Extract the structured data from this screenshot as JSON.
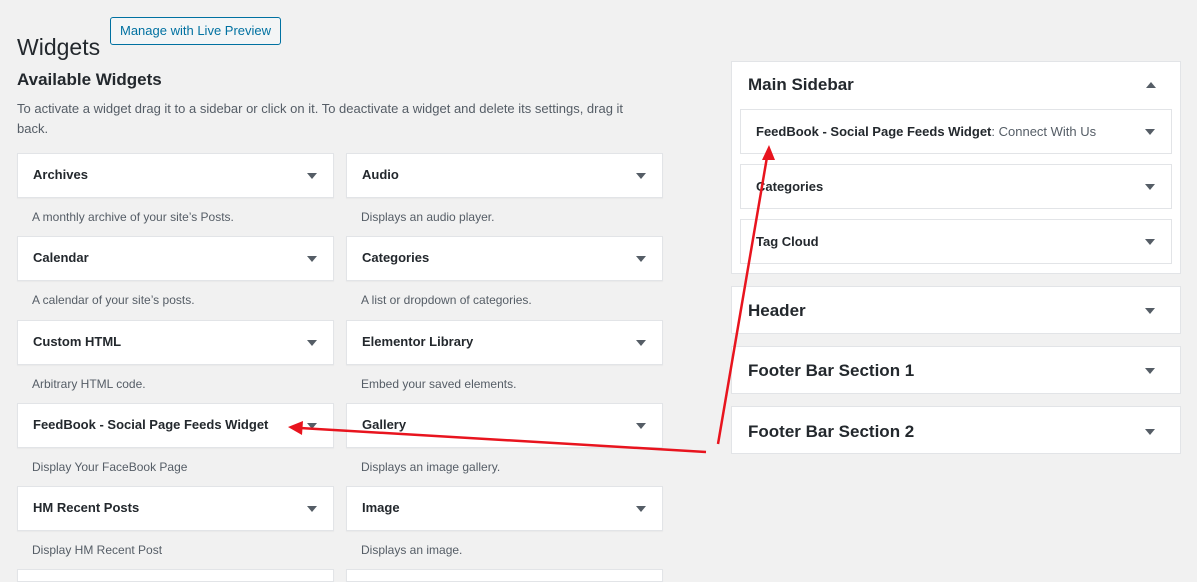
{
  "header": {
    "title": "Widgets",
    "live_preview_label": "Manage with Live Preview"
  },
  "available": {
    "title": "Available Widgets",
    "description": "To activate a widget drag it to a sidebar or click on it. To deactivate a widget and delete its settings, drag it back.",
    "widgets": [
      {
        "name": "Archives",
        "desc": "A monthly archive of your site’s Posts."
      },
      {
        "name": "Audio",
        "desc": "Displays an audio player."
      },
      {
        "name": "Calendar",
        "desc": "A calendar of your site’s posts."
      },
      {
        "name": "Categories",
        "desc": "A list or dropdown of categories."
      },
      {
        "name": "Custom HTML",
        "desc": "Arbitrary HTML code."
      },
      {
        "name": "Elementor Library",
        "desc": "Embed your saved elements."
      },
      {
        "name": "FeedBook - Social Page Feeds Widget",
        "desc": "Display Your FaceBook Page"
      },
      {
        "name": "Gallery",
        "desc": "Displays an image gallery."
      },
      {
        "name": "HM Recent Posts",
        "desc": "Display HM Recent Post"
      },
      {
        "name": "Image",
        "desc": "Displays an image."
      }
    ]
  },
  "sidebars": {
    "main": {
      "title": "Main Sidebar",
      "widgets": [
        {
          "name": "FeedBook - Social Page Feeds Widget",
          "instance": ": Connect With Us"
        },
        {
          "name": "Categories",
          "instance": ""
        },
        {
          "name": "Tag Cloud",
          "instance": ""
        }
      ]
    },
    "header": {
      "title": "Header"
    },
    "footer1": {
      "title": "Footer Bar Section 1"
    },
    "footer2": {
      "title": "Footer Bar Section 2"
    }
  },
  "annotation_color": "#e8141e"
}
